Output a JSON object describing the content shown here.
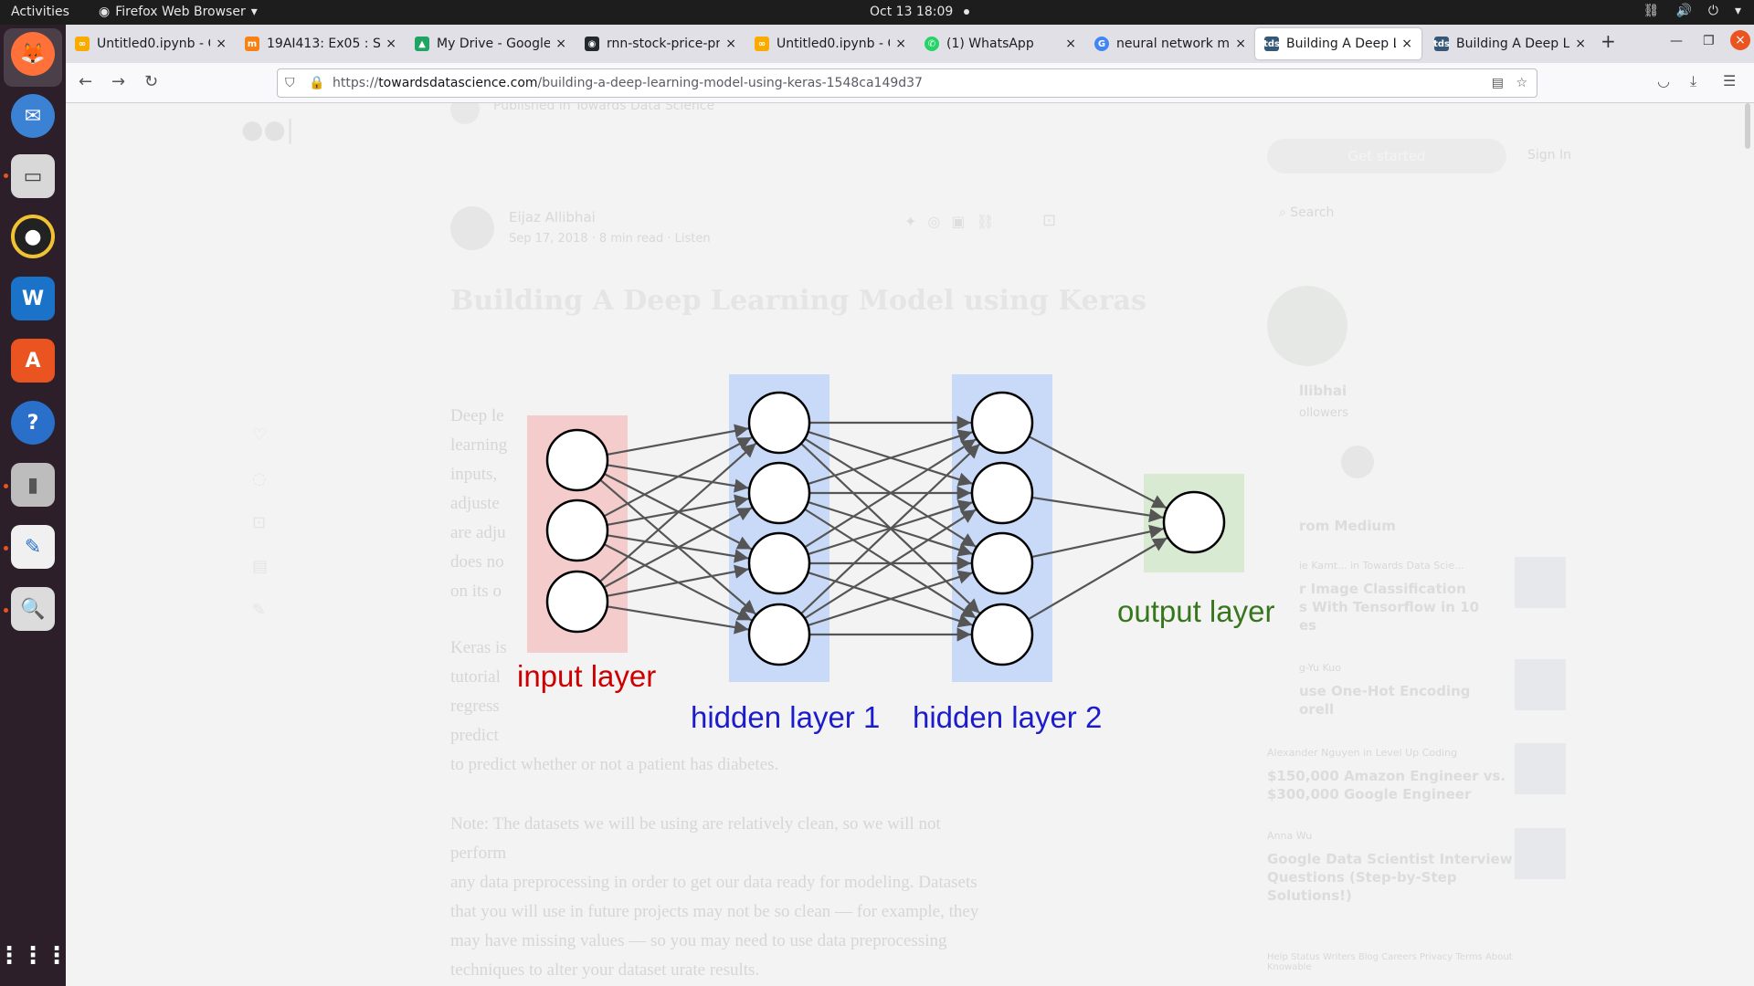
{
  "topbar": {
    "activities": "Activities",
    "app_name": "Firefox Web Browser",
    "clock": "Oct 13  18:09"
  },
  "tabs": [
    {
      "title": "Untitled0.ipynb - Co",
      "icon": "colab-icon",
      "color": "#f9ab00",
      "active": false
    },
    {
      "title": "19AI413: Ex05 : Sto",
      "icon": "moodle-icon",
      "color": "#f98012",
      "active": false
    },
    {
      "title": "My Drive - Google D",
      "icon": "google-drive-icon",
      "color": "#1fa463",
      "active": false
    },
    {
      "title": "rnn-stock-price-pre",
      "icon": "github-icon",
      "color": "#24292e",
      "active": false
    },
    {
      "title": "Untitled0.ipynb - Co",
      "icon": "colab-icon",
      "color": "#f9ab00",
      "active": false
    },
    {
      "title": "(1) WhatsApp",
      "icon": "whatsapp-icon",
      "color": "#25d366",
      "active": false
    },
    {
      "title": "neural network mo",
      "icon": "google-icon",
      "color": "#4285f4",
      "active": false
    },
    {
      "title": "Building A Deep Le",
      "icon": "tds-icon",
      "color": "#355876",
      "active": true
    },
    {
      "title": "Building A Deep Le",
      "icon": "tds-icon",
      "color": "#355876",
      "active": false
    }
  ],
  "navbar": {
    "url_prefix": "https://",
    "url_domain": "towardsdatascience.com",
    "url_path": "/building-a-deep-learning-model-using-keras-1548ca149d37"
  },
  "article": {
    "publisher": "Published in Towards Data Science",
    "author": "Eijaz Allibhai",
    "meta": "Sep 17, 2018 · 8 min read · Listen",
    "title": "Building A Deep Learning Model using Keras",
    "para_lines": [
      "Deep le",
      "learning",
      "inputs,",
      "adjuste",
      "are adju",
      "does no",
      "on its o"
    ],
    "para2_lines": [
      "Keras is",
      "tutorial",
      "regress",
      "predict",
      "to predict whether or not a patient has diabetes."
    ],
    "note_lines": [
      "Note: The datasets we will be using are relatively clean, so we will not perform",
      "any data preprocessing in order to get our data ready for modeling. Datasets",
      "that you will use in future projects may not be so clean — for example, they",
      "may have missing values — so you may need to use data preprocessing",
      "techniques to alter your dataset",
      "urate results."
    ]
  },
  "sidebar": {
    "get_started": "Get started",
    "sign_in": "Sign In",
    "search": "Search",
    "author_name": "llibhai",
    "followers": "ollowers",
    "more_from": "rom Medium",
    "stories": [
      {
        "author": "ie Kamt... in Towards Data Scie...",
        "title_lines": [
          "r Image Classification",
          "s With Tensorflow in 10",
          "es"
        ]
      },
      {
        "author": "g-Yu Kuo",
        "title_lines": [
          "use One-Hot Encoding",
          "orell"
        ]
      },
      {
        "author": "Alexander Nguyen in Level Up Coding",
        "title_lines": [
          "$150,000 Amazon Engineer vs.",
          "$300,000 Google Engineer"
        ]
      },
      {
        "author": "Anna Wu",
        "title_lines": [
          "Google Data Scientist Interview",
          "Questions (Step-by-Step",
          "Solutions!)"
        ]
      }
    ],
    "footer": "Help  Status  Writers  Blog  Careers  Privacy  Terms  About  Knowable"
  },
  "diagram": {
    "input_label": "input layer",
    "hidden1_label": "hidden layer 1",
    "hidden2_label": "hidden layer 2",
    "output_label": "output layer",
    "layers": [
      3,
      4,
      4,
      1
    ],
    "colors": {
      "input_box": "#f4cccc",
      "hidden_box": "#c9daf8",
      "output_box": "#d9ead3",
      "input_text": "#cc0000",
      "hidden_text": "#1c1ccc",
      "output_text": "#38761d"
    }
  }
}
